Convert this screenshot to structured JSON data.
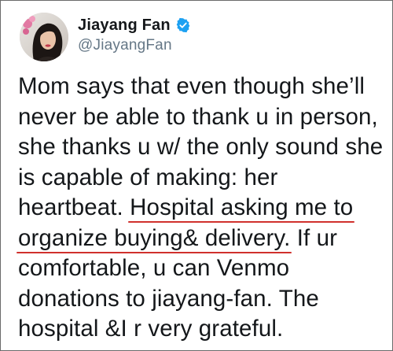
{
  "tweet": {
    "author": {
      "display_name": "Jiayang Fan",
      "handle": "@JiayangFan",
      "verified": true,
      "verified_icon": "verified-badge-icon",
      "verified_color": "#1da1f2"
    },
    "lines": [
      {
        "parts": [
          {
            "text": "Mom says that even though she’ll",
            "underlined": false
          }
        ]
      },
      {
        "parts": [
          {
            "text": "never be able to thank u in person,",
            "underlined": false
          }
        ]
      },
      {
        "parts": [
          {
            "text": "she thanks u w/ the only sound she",
            "underlined": false
          }
        ]
      },
      {
        "parts": [
          {
            "text": "is capable of making: her",
            "underlined": false
          }
        ]
      },
      {
        "parts": [
          {
            "text": "heartbeat. ",
            "underlined": false
          },
          {
            "text": "Hospital asking me to",
            "underlined": true
          }
        ]
      },
      {
        "parts": [
          {
            "text": "organize buying& delivery.",
            "underlined": true
          },
          {
            "text": " If ur",
            "underlined": false
          }
        ]
      },
      {
        "parts": [
          {
            "text": "comfortable, u can Venmo",
            "underlined": false
          }
        ]
      },
      {
        "parts": [
          {
            "text": "donations to jiayang-fan. The",
            "underlined": false
          }
        ]
      },
      {
        "parts": [
          {
            "text": "hospital &I r very grateful.",
            "underlined": false
          }
        ]
      }
    ],
    "annotation_color": "#d0312d"
  }
}
